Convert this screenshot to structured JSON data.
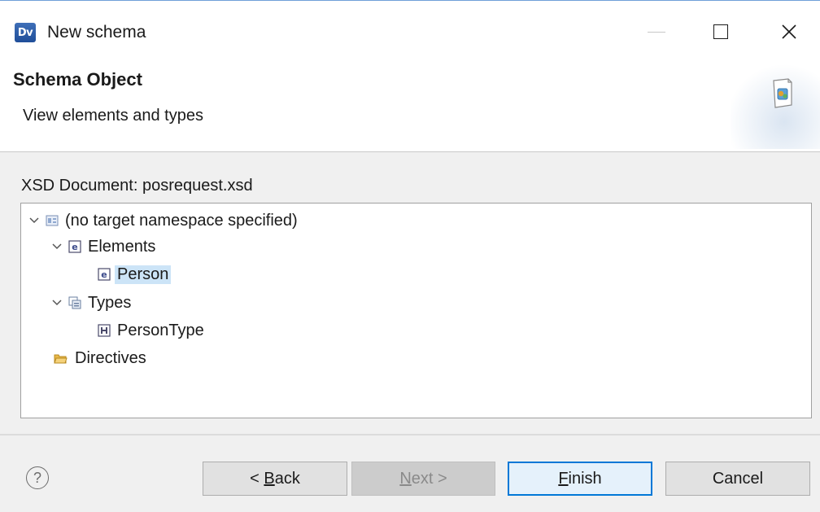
{
  "window": {
    "app_icon_text": "Dv",
    "title": "New schema"
  },
  "banner": {
    "title": "Schema Object",
    "description": "View elements and types"
  },
  "content": {
    "xsd_label": "XSD Document: posrequest.xsd",
    "tree": {
      "root": "(no target namespace specified)",
      "elements": "Elements",
      "person": "Person",
      "types": "Types",
      "person_type": "PersonType",
      "directives": "Directives"
    }
  },
  "buttons": {
    "help": "?",
    "back_prefix": "< ",
    "back_mnemonic": "B",
    "back_rest": "ack",
    "next_mnemonic": "N",
    "next_rest": "ext >",
    "finish_mnemonic": "F",
    "finish_rest": "inish",
    "cancel": "Cancel"
  },
  "colors": {
    "selection": "#cce4f7",
    "default_button_border": "#0078d7",
    "dialog_background": "#f0f0f0"
  },
  "icons": {
    "app": "dv-app-icon",
    "minimize": "minimize-icon",
    "maximize": "maximize-icon",
    "close": "close-icon",
    "banner": "schema-wizard-icon",
    "root": "namespace-icon",
    "element": "element-icon",
    "types": "types-icon",
    "complex_type": "complex-type-icon",
    "directives": "folder-icon"
  }
}
